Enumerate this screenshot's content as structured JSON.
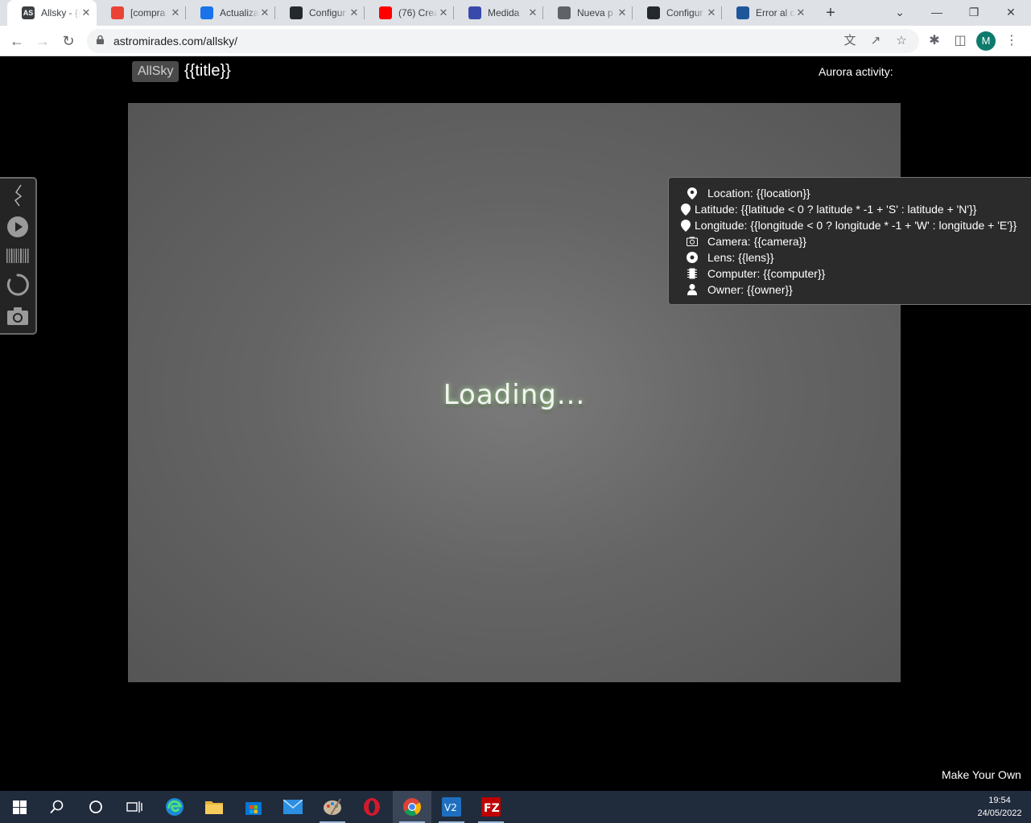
{
  "browser": {
    "tabs": [
      {
        "title": "Allsky - {{",
        "favicon": "AS",
        "color": "#3c4043",
        "active": true
      },
      {
        "title": "[compra",
        "favicon": "gmail-icon",
        "color": "#ea4335",
        "active": false
      },
      {
        "title": "Actualiza",
        "favicon": "globe-icon",
        "color": "#1a73e8",
        "active": false
      },
      {
        "title": "Configur",
        "favicon": "github-icon",
        "color": "#24292e",
        "active": false
      },
      {
        "title": "(76) Crea",
        "favicon": "youtube-icon",
        "color": "#ff0000",
        "active": false
      },
      {
        "title": "Medida",
        "favicon": "brand-icon",
        "color": "#3949ab",
        "active": false
      },
      {
        "title": "Nueva p",
        "favicon": "chrome-icon",
        "color": "#5f6368",
        "active": false
      },
      {
        "title": "Configur",
        "favicon": "github-icon",
        "color": "#24292e",
        "active": false
      },
      {
        "title": "Error al c",
        "favicon": "app-icon",
        "color": "#1e5799",
        "active": false
      }
    ],
    "url": "astromirades.com/allsky/",
    "profile_initial": "M"
  },
  "page": {
    "brand": "AllSky",
    "title": "{{title}}",
    "aurora_label": "Aurora activity:",
    "loading_text": "Loading...",
    "info": {
      "location": "Location: {{location}}",
      "latitude": "Latitude: {{latitude < 0 ? latitude * -1 + 'S' : latitude + 'N'}}",
      "longitude": "Longitude: {{longitude < 0 ? longitude * -1 + 'W' : longitude + 'E'}}",
      "camera": "Camera: {{camera}}",
      "lens": "Lens: {{lens}}",
      "computer": "Computer: {{computer}}",
      "owner": "Owner: {{owner}}"
    },
    "footer_link": "Make Your Own"
  },
  "taskbar": {
    "time": "19:54",
    "date": "24/05/2022"
  }
}
